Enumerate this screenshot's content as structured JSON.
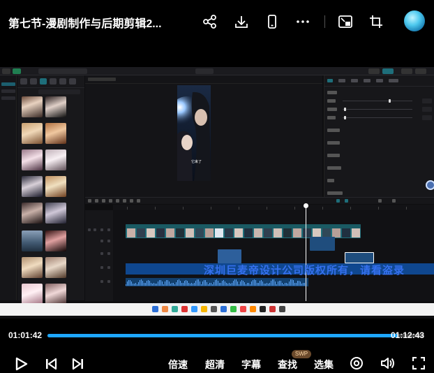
{
  "header": {
    "title": "第七节-漫剧制作与后期剪辑2...",
    "icons": [
      "share-icon",
      "download-icon",
      "phone-icon",
      "more-icon",
      "pip-icon",
      "crop-icon",
      "avatar"
    ]
  },
  "video_frame": {
    "editor_caption": "它来了",
    "watermark": "深圳巨麦帝设计公司版权所有，请看盗录",
    "swatches": {
      "accent_teal": "#1e6e7a",
      "track_blue": "#0f4fa0"
    }
  },
  "player": {
    "current_time": "01:01:42",
    "total_time": "01:12:43",
    "progress": 0.93
  },
  "controls": {
    "speed": "倍速",
    "quality": "超清",
    "subtitle": "字幕",
    "search": "查找",
    "search_badge": "SWP",
    "episodes": "选集"
  },
  "colors": {
    "progress": "#1ea7ff",
    "background": "#000000"
  }
}
